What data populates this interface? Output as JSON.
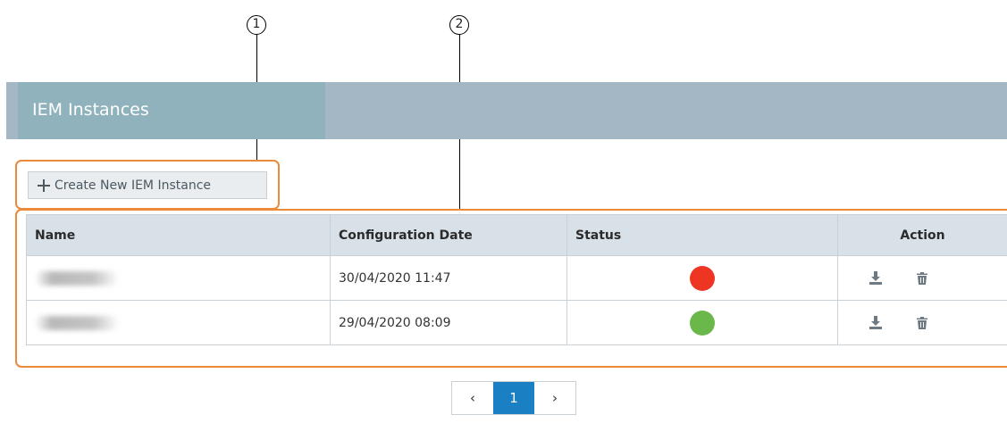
{
  "callouts": [
    "1",
    "2"
  ],
  "header": {
    "title": "IEM Instances"
  },
  "toolbar": {
    "create_label": "Create New IEM Instance"
  },
  "table": {
    "columns": [
      "Name",
      "Configuration Date",
      "Status",
      "Action"
    ],
    "rows": [
      {
        "name": "",
        "date": "30/04/2020 11:47",
        "status": "error",
        "status_color": "#ee3524"
      },
      {
        "name": "",
        "date": "29/04/2020 08:09",
        "status": "ok",
        "status_color": "#6ab84a"
      }
    ]
  },
  "icons": {
    "download": "download-icon",
    "delete": "trash-icon"
  },
  "pagination": {
    "prev": "‹",
    "current": "1",
    "next": "›"
  },
  "colors": {
    "accent": "#1b7fc4",
    "highlight": "#ec8a3a",
    "header": "#a3b8c4"
  }
}
